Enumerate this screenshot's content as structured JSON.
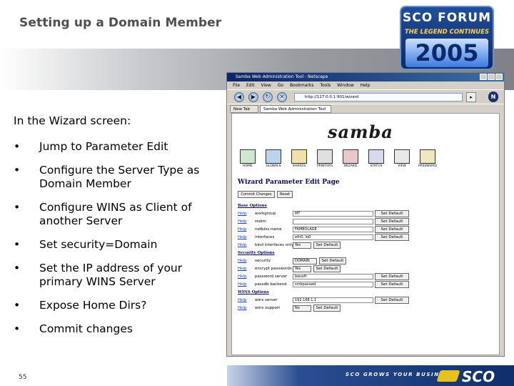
{
  "slide": {
    "title": "Setting up a Domain Member",
    "page_number": "55",
    "intro": "In the Wizard screen:",
    "bullet_glyph": "•",
    "bullets": [
      "Jump to Parameter Edit",
      "Configure the Server Type as Domain Member",
      "Configure WINS as Client of another Server",
      "Set security=Domain",
      "Set the IP address of your primary WINS Server",
      "Expose Home Dirs?",
      "Commit changes"
    ]
  },
  "forum_logo": {
    "line1": "SCO FORUM",
    "line2": "THE LEGEND CONTINUES",
    "line3": "2005"
  },
  "footer": {
    "slogan": "SCO GROWS YOUR BUSINESS",
    "logo_text": "SCO"
  },
  "browser": {
    "window_title": "Samba Web Administration Tool - Netscape",
    "menu": [
      "File",
      "Edit",
      "View",
      "Go",
      "Bookmarks",
      "Tools",
      "Window",
      "Help"
    ],
    "url": "http://127.0.0.1:901/wizard",
    "tabs": [
      "New Tab",
      "Samba Web Administration Tool"
    ],
    "page": {
      "logo": "samba",
      "nav_items": [
        "HOME",
        "GLOBALS",
        "SHARES",
        "PRINTERS",
        "WIZARD",
        "STATUS",
        "VIEW",
        "PASSWORD"
      ],
      "title": "Wizard Parameter Edit Page",
      "commit_button": "Commit Changes",
      "reset_button": "Reset",
      "help_label": "Help",
      "set_default_label": "Set Default",
      "sections": {
        "base": "Base Options",
        "security": "Security Options",
        "wins": "WINS Options"
      },
      "base_options": [
        {
          "name": "workgroup",
          "value": "MT"
        },
        {
          "name": "realm",
          "value": ""
        },
        {
          "name": "netbios name",
          "value": "FAMBOLAGE"
        },
        {
          "name": "interfaces",
          "value": "eth0, lo0"
        },
        {
          "name": "bind interfaces only",
          "value": "Yes"
        }
      ],
      "security_options": [
        {
          "name": "security",
          "value": "DOMAIN"
        },
        {
          "name": "encrypt passwords",
          "value": "Yes"
        },
        {
          "name": "password server",
          "value": "bwsoft"
        },
        {
          "name": "passdb backend",
          "value": "smbpasswd"
        }
      ],
      "wins_options": [
        {
          "name": "wins server",
          "value": "192.168.1.1"
        },
        {
          "name": "wins support",
          "value": "No"
        }
      ]
    }
  }
}
